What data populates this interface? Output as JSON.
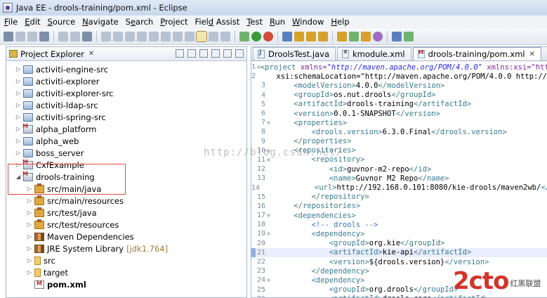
{
  "window": {
    "title": "Java EE - drools-training/pom.xml - Eclipse"
  },
  "menu": [
    {
      "label": "File",
      "mnemonic_index": 0
    },
    {
      "label": "Edit",
      "mnemonic_index": 0
    },
    {
      "label": "Source",
      "mnemonic_index": 0
    },
    {
      "label": "Navigate",
      "mnemonic_index": 0
    },
    {
      "label": "Search",
      "mnemonic_index": 1
    },
    {
      "label": "Project",
      "mnemonic_index": 0
    },
    {
      "label": "Field Assist",
      "mnemonic_index": 4
    },
    {
      "label": "Test",
      "mnemonic_index": 0
    },
    {
      "label": "Run",
      "mnemonic_index": 0
    },
    {
      "label": "Window",
      "mnemonic_index": 0
    },
    {
      "label": "Help",
      "mnemonic_index": 0
    }
  ],
  "explorer": {
    "title": "Project Explorer",
    "items": [
      {
        "label": "activiti-engine-src",
        "icon": "project-icon",
        "twisty": "▷",
        "level": 0
      },
      {
        "label": "activiti-explorer",
        "icon": "project-icon",
        "twisty": "▷",
        "level": 0
      },
      {
        "label": "activiti-explorer-src",
        "icon": "project-icon",
        "twisty": "▷",
        "level": 0
      },
      {
        "label": "activiti-ldap-src",
        "icon": "project-icon",
        "twisty": "▷",
        "level": 0
      },
      {
        "label": "activiti-spring-src",
        "icon": "project-icon",
        "twisty": "▷",
        "level": 0
      },
      {
        "label": "alpha_platform",
        "icon": "maven-project-icon",
        "twisty": "▷",
        "level": 0
      },
      {
        "label": "alpha_web",
        "icon": "project-icon",
        "twisty": "▷",
        "level": 0
      },
      {
        "label": "boss_server",
        "icon": "project-icon",
        "twisty": "▷",
        "level": 0
      },
      {
        "label": "CxfExample",
        "icon": "maven-project-icon",
        "twisty": "▷",
        "level": 0
      },
      {
        "label": "drools-training",
        "icon": "maven-project-icon",
        "twisty": "◢",
        "level": 0
      },
      {
        "label": "src/main/java",
        "icon": "package-folder-icon",
        "twisty": "▷",
        "level": 1
      },
      {
        "label": "src/main/resources",
        "icon": "package-folder-icon",
        "twisty": "▷",
        "level": 1
      },
      {
        "label": "src/test/java",
        "icon": "package-folder-icon",
        "twisty": "▷",
        "level": 1
      },
      {
        "label": "src/test/resources",
        "icon": "package-folder-icon",
        "twisty": "▷",
        "level": 1
      },
      {
        "label": "Maven Dependencies",
        "icon": "library-icon",
        "twisty": "▷",
        "level": 1
      },
      {
        "label": "JRE System Library",
        "suffix": "[jdk1.764]",
        "icon": "library-icon",
        "twisty": "▷",
        "level": 1
      },
      {
        "label": "src",
        "icon": "folder-icon",
        "twisty": "▷",
        "level": 1
      },
      {
        "label": "target",
        "icon": "folder-icon",
        "twisty": "▷",
        "level": 1
      },
      {
        "label": "pom.xml",
        "icon": "pom-file-icon",
        "twisty": "",
        "level": 1,
        "bold": true
      }
    ]
  },
  "editor": {
    "tabs": [
      {
        "label": "DroolsTest.java",
        "icon": "java-file-icon",
        "active": false
      },
      {
        "label": "kmodule.xml",
        "icon": "xml-file-icon",
        "active": false
      },
      {
        "label": "drools-training/pom.xml",
        "icon": "pom-file-icon",
        "active": true
      }
    ],
    "lines": [
      {
        "n": "1",
        "fold": "⊖",
        "code": "<project xmlns=\"http://maven.apache.org/POM/4.0.0\" xmlns:xsi=\"http"
      },
      {
        "n": "2",
        "fold": "",
        "code": "    xsi:schemaLocation=\"http://maven.apache.org/POM/4.0.0 http://"
      },
      {
        "n": "3",
        "fold": "",
        "code": "    <modelVersion>4.0.0</modelVersion>"
      },
      {
        "n": "4",
        "fold": "",
        "code": "    <groupId>os.nut.drools</groupId>"
      },
      {
        "n": "5",
        "fold": "",
        "code": "    <artifactId>drools-training</artifactId>"
      },
      {
        "n": "6",
        "fold": "",
        "code": "    <version>0.0.1-SNAPSHOT</version>"
      },
      {
        "n": "7",
        "fold": "⊖",
        "code": "    <properties>"
      },
      {
        "n": "8",
        "fold": "",
        "code": "        <drools.version>6.3.0.Final</drools.version>"
      },
      {
        "n": "9",
        "fold": "",
        "code": "    </properties>"
      },
      {
        "n": "10",
        "fold": "⊖",
        "code": "    <repositories>"
      },
      {
        "n": "11",
        "fold": "⊖",
        "code": "        <repository>"
      },
      {
        "n": "12",
        "fold": "",
        "code": "            <id>guvnor-m2-repo</id>"
      },
      {
        "n": "13",
        "fold": "",
        "code": "            <name>Guvnor M2 Repo</name>"
      },
      {
        "n": "14",
        "fold": "",
        "code": "            <url>http://192.168.0.101:8080/kie-drools/maven2wb/</url>"
      },
      {
        "n": "15",
        "fold": "",
        "code": "        </repository>"
      },
      {
        "n": "16",
        "fold": "",
        "code": "    </repositories>"
      },
      {
        "n": "17",
        "fold": "⊖",
        "code": "    <dependencies>"
      },
      {
        "n": "18",
        "fold": "",
        "code": "        <!-- drools -->"
      },
      {
        "n": "19",
        "fold": "⊖",
        "code": "        <dependency>"
      },
      {
        "n": "20",
        "fold": "",
        "code": "            <groupId>org.kie</groupId>"
      },
      {
        "n": "21",
        "fold": "",
        "code": "            <artifactId>kie-api</artifactId>",
        "current": true
      },
      {
        "n": "22",
        "fold": "",
        "code": "            <version>${drools.version}</version>"
      },
      {
        "n": "23",
        "fold": "",
        "code": "        </dependency>"
      },
      {
        "n": "24",
        "fold": "⊖",
        "code": "        <dependency>"
      },
      {
        "n": "25",
        "fold": "",
        "code": "            <groupId>org.drools</groupId>"
      },
      {
        "n": "26",
        "fold": "",
        "code": "            <artifactId>drools-core</artifactId>"
      }
    ]
  },
  "watermark": "http://blog.csdn.net/",
  "logo": {
    "main": "2cto",
    "sub": "红黑联盟"
  },
  "colors": {
    "highlight_box": "#e5483d",
    "logo_red": "#d4342c"
  }
}
